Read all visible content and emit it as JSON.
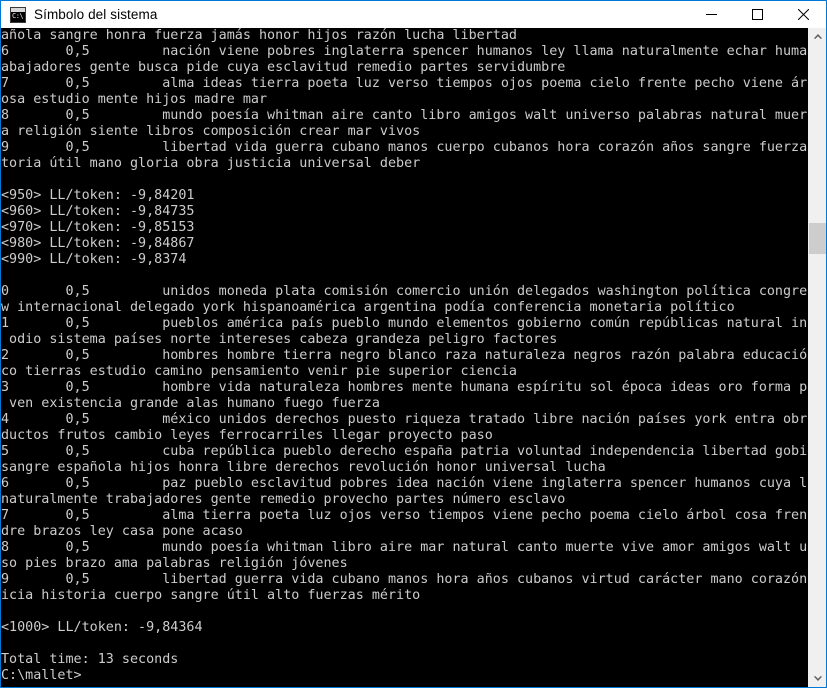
{
  "window": {
    "title": "Símbolo del sistema",
    "icon_name": "cmd-console-icon",
    "icon_glyph": "C:\\",
    "accent_color": "#0078d7",
    "titlebar_bg": "#ffffff",
    "console_bg": "#000000",
    "console_fg": "#cccccc",
    "controls": {
      "minimize_label": "Minimizar",
      "maximize_label": "Maximizar",
      "close_label": "Cerrar"
    }
  },
  "scrollbar": {
    "up_arrow_label": "Desplazar hacia arriba",
    "down_arrow_label": "Desplazar hacia abajo",
    "thumb_top_percent": 30,
    "thumb_height_percent": 5
  },
  "console": {
    "lines": [
      "añola sangre honra fuerza jamás honor hijos razón lucha libertad",
      "6\t0,5\tnación viene pobres inglaterra spencer humanos ley llama naturalmente echar humana tr",
      "abajadores gente busca pide cuya esclavitud remedio partes servidumbre",
      "7\t0,5\talma ideas tierra poeta luz verso tiempos ojos poema cielo frente pecho viene árbol c",
      "osa estudio mente hijos madre mar",
      "8\t0,5\tmundo poesía whitman aire canto libro amigos walt universo palabras natural muerte am",
      "a religión siente libros composición crear mar vivos",
      "9\t0,5\tlibertad vida guerra cubano manos cuerpo cubanos hora corazón años sangre fuerzas his",
      "toria útil mano gloria obra justicia universal deber",
      "",
      "<950> LL/token: -9,84201",
      "<960> LL/token: -9,84735",
      "<970> LL/token: -9,85153",
      "<980> LL/token: -9,84867",
      "<990> LL/token: -9,8374",
      "",
      "0\t0,5\tunidos moneda plata comisión comercio unión delegados washington política congreso ne",
      "w internacional delegado york hispanoamérica argentina podía conferencia monetaria político",
      "1\t0,5\tpueblos américa país pueblo mundo elementos gobierno común repúblicas natural interés",
      " odio sistema países norte intereses cabeza grandeza peligro factores",
      "2\t0,5\thombres hombre tierra negro blanco raza naturaleza negros razón palabra educación úni",
      "co tierras estudio camino pensamiento venir pie superior ciencia",
      "3\t0,5\thombre vida naturaleza hombres mente humana espíritu sol época ideas oro forma poetas",
      " ven existencia grande alas humano fuego fuerza",
      "4\t0,5\tméxico unidos derechos puesto riqueza tratado libre nación países york entra obra pro",
      "ductos frutos cambio leyes ferrocarriles llegar proyecto paso",
      "5\t0,5\tcuba república pueblo derecho españa patria voluntad independencia libertad gobierno",
      "sangre española hijos honra libre derechos revolución honor universal lucha",
      "6\t0,5\tpaz pueblo esclavitud pobres idea nación viene inglaterra spencer humanos cuya llama",
      "naturalmente trabajadores gente remedio provecho partes número esclavo",
      "7\t0,5\talma tierra poeta luz ojos verso tiempos viene pecho poema cielo árbol cosa frente ma",
      "dre brazos ley casa pone acaso",
      "8\t0,5\tmundo poesía whitman libro aire mar natural canto muerte vive amor amigos walt univer",
      "so pies brazo ama palabras religión jóvenes",
      "9\t0,5\tlibertad guerra vida cubano manos hora años cubanos virtud carácter mano corazón just",
      "icia historia cuerpo sangre útil alto fuerzas mérito",
      "",
      "<1000> LL/token: -9,84364",
      "",
      "Total time: 13 seconds",
      "C:\\mallet>"
    ]
  }
}
